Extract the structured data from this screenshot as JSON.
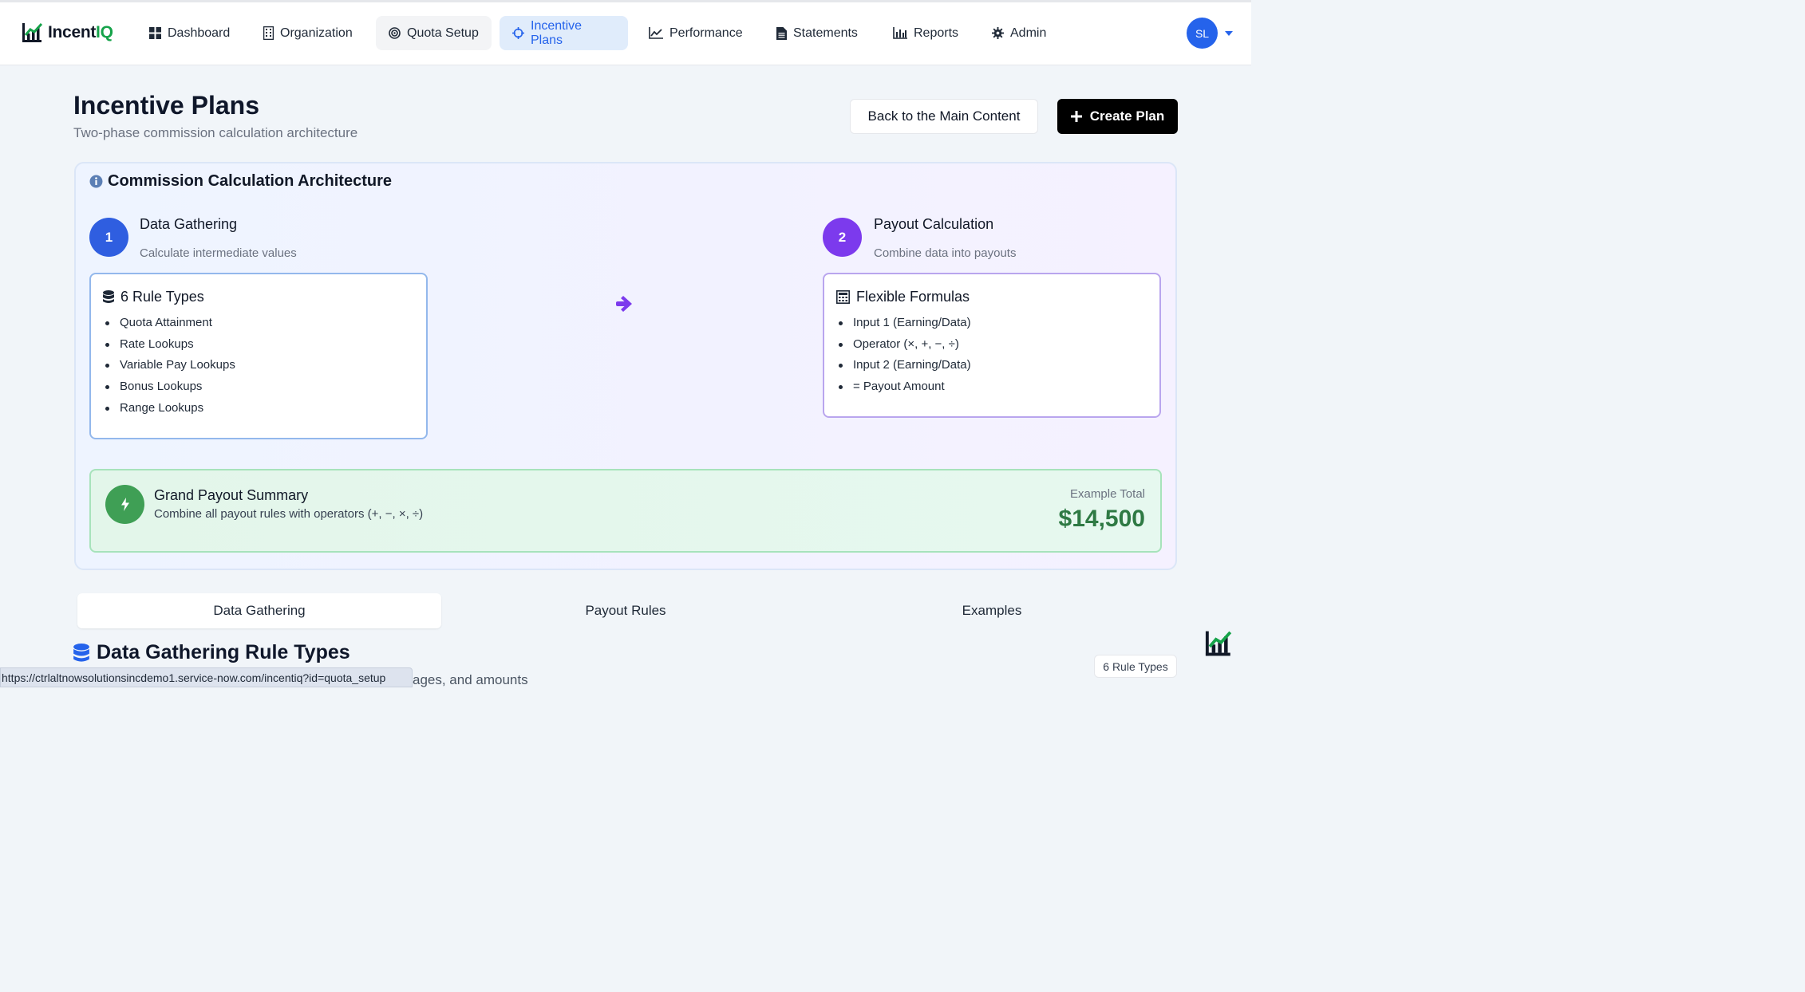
{
  "app": {
    "name_prefix": "Incent",
    "name_suffix": "IQ"
  },
  "nav": {
    "items": [
      {
        "label": "Dashboard",
        "icon": "grid-icon"
      },
      {
        "label": "Organization",
        "icon": "building-icon"
      },
      {
        "label": "Quota Setup",
        "icon": "target-icon"
      },
      {
        "label": "Incentive Plans",
        "icon": "crosshair-icon"
      },
      {
        "label": "Performance",
        "icon": "line-chart-icon"
      },
      {
        "label": "Statements",
        "icon": "document-icon"
      },
      {
        "label": "Reports",
        "icon": "bar-chart-icon"
      },
      {
        "label": "Admin",
        "icon": "gear-icon"
      }
    ],
    "active": "Incentive Plans",
    "avatar_initials": "SL"
  },
  "header": {
    "title": "Incentive Plans",
    "subtitle": "Two-phase commission calculation architecture",
    "back_label": "Back to the Main Content",
    "create_label": "Create Plan"
  },
  "architecture": {
    "title": "Commission Calculation Architecture",
    "phase1": {
      "number": "1",
      "title": "Data Gathering",
      "subtitle": "Calculate intermediate values",
      "box_title": "6 Rule Types",
      "items": [
        "Quota Attainment",
        "Rate Lookups",
        "Variable Pay Lookups",
        "Bonus Lookups",
        "Range Lookups"
      ]
    },
    "phase2": {
      "number": "2",
      "title": "Payout Calculation",
      "subtitle": "Combine data into payouts",
      "box_title": "Flexible Formulas",
      "items": [
        "Input 1 (Earning/Data)",
        "Operator (×, +, −, ÷)",
        "Input 2 (Earning/Data)",
        "= Payout Amount"
      ]
    },
    "summary": {
      "title": "Grand Payout Summary",
      "description": "Combine all payout rules with operators (+, −, ×, ÷)",
      "total_label": "Example Total",
      "total_value": "$14,500"
    }
  },
  "tabs": [
    "Data Gathering",
    "Payout Rules",
    "Examples"
  ],
  "section": {
    "title": "Data Gathering Rule Types",
    "description_fragment": "ages, and amounts",
    "badge": "6 Rule Types"
  },
  "status_bar": {
    "url": "https://ctrlaltnowsolutionsincdemo1.service-now.com/incentiq?id=quota_setup"
  },
  "colors": {
    "primary": "#2563eb",
    "purple": "#7c3aed",
    "green": "#3f9f55",
    "amount_green": "#2f7a44"
  }
}
